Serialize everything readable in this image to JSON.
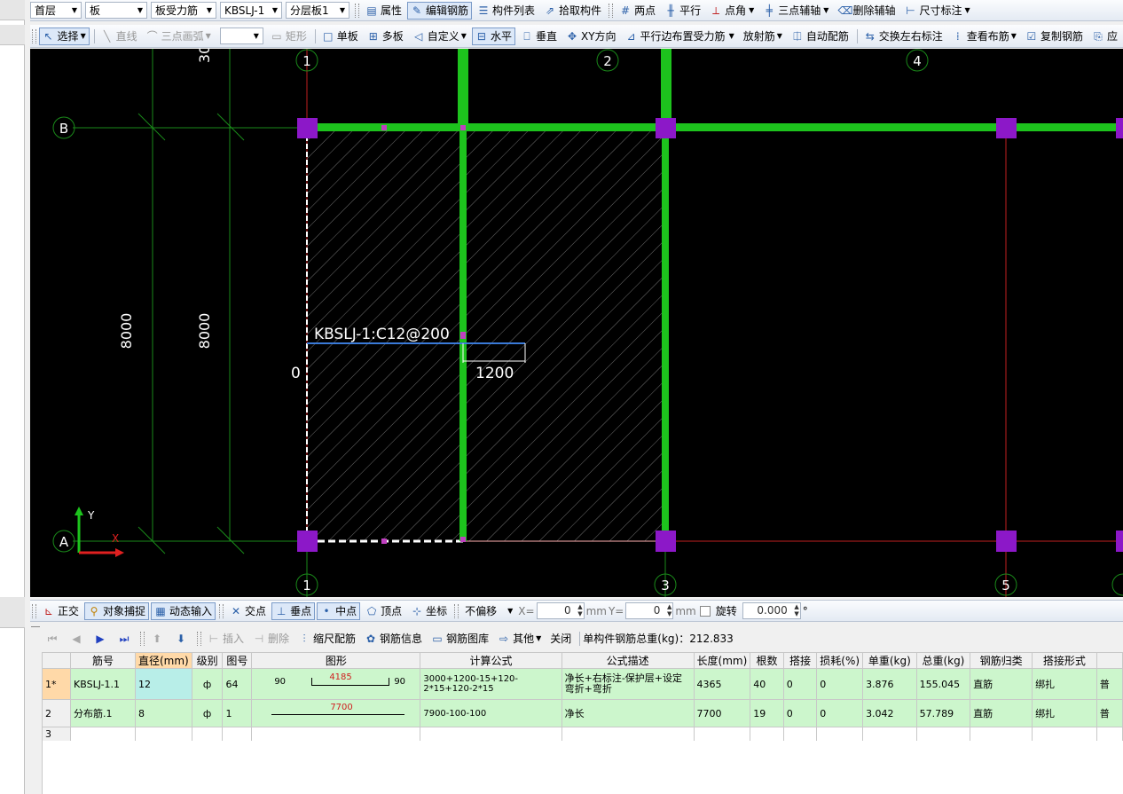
{
  "toolbar1": {
    "floor": "首层",
    "category": "板",
    "component_type": "板受力筋",
    "component_name": "KBSLJ-1",
    "layer": "分层板1",
    "buttons": [
      "属性",
      "编辑钢筋",
      "构件列表",
      "拾取构件",
      "两点",
      "平行",
      "点角",
      "三点辅轴",
      "删除辅轴",
      "尺寸标注"
    ]
  },
  "toolbar2": {
    "select": "选择",
    "line": "直线",
    "arc": "三点画弧",
    "rect": "矩形",
    "single_board": "单板",
    "multi_board": "多板",
    "custom": "自定义",
    "horizontal": "水平",
    "vertical": "垂直",
    "xy_direction": "XY方向",
    "parallel_edge": "平行边布置受力筋",
    "radial": "放射筋",
    "auto_rebar": "自动配筋",
    "swap_label": "交换左右标注",
    "view_rebar": "查看布筋",
    "copy_rebar": "复制钢筋",
    "apply": "应"
  },
  "canvas": {
    "axis_top": [
      "1",
      "2",
      "4"
    ],
    "axis_bottom": [
      "1",
      "3",
      "5"
    ],
    "axis_left": [
      "B",
      "A"
    ],
    "dim_vertical_1": "8000",
    "dim_vertical_2": "8000",
    "dim_top_partial": "30",
    "rebar_label": "KBSLJ-1:C12@200",
    "left_extension": "0",
    "right_extension": "1200",
    "ucs_y": "Y",
    "ucs_x": "X"
  },
  "snapbar": {
    "ortho": "正交",
    "object_snap": "对象捕捉",
    "dynamic_input": "动态输入",
    "intersection": "交点",
    "perpendicular": "垂点",
    "midpoint": "中点",
    "vertex": "顶点",
    "coordinate": "坐标",
    "offset_mode": "不偏移",
    "x_label": "X=",
    "x_value": "0",
    "unit_x": "mm",
    "y_label": "Y=",
    "y_value": "0",
    "unit_y": "mm",
    "rotate_label": "旋转",
    "rotate_value": "0.000",
    "degree": "°"
  },
  "panel_toolbar": {
    "insert": "插入",
    "delete": "删除",
    "scale_rebar": "缩尺配筋",
    "rebar_info": "钢筋信息",
    "rebar_library": "钢筋图库",
    "other": "其他",
    "close": "关闭",
    "total_weight": "单构件钢筋总重(kg)：212.833"
  },
  "table": {
    "headers": [
      "",
      "筋号",
      "直径(mm)",
      "级别",
      "图号",
      "图形",
      "计算公式",
      "公式描述",
      "长度(mm)",
      "根数",
      "搭接",
      "损耗(%)",
      "单重(kg)",
      "总重(kg)",
      "钢筋归类",
      "搭接形式",
      ""
    ],
    "rows": [
      {
        "num": "1*",
        "name": "KBSLJ-1.1",
        "diameter": "12",
        "grade": "ф",
        "shape_no": "64",
        "shape_left": "90",
        "shape_mid": "4185",
        "shape_right": "90",
        "formula": "3000+1200-15+120-2*15+120-2*15",
        "desc": "净长+右标注-保护层+设定弯折+弯折",
        "length": "4365",
        "count": "40",
        "lap": "0",
        "loss": "0",
        "unit_weight": "3.876",
        "total_weight": "155.045",
        "category": "直筋",
        "lap_type": "绑扎",
        "extra": "普"
      },
      {
        "num": "2",
        "name": "分布筋.1",
        "diameter": "8",
        "grade": "ф",
        "shape_no": "1",
        "shape_mid": "7700",
        "formula": "7900-100-100",
        "desc": "净长",
        "length": "7700",
        "count": "19",
        "lap": "0",
        "loss": "0",
        "unit_weight": "3.042",
        "total_weight": "57.789",
        "category": "直筋",
        "lap_type": "绑扎",
        "extra": "普"
      },
      {
        "num": "3"
      }
    ]
  }
}
